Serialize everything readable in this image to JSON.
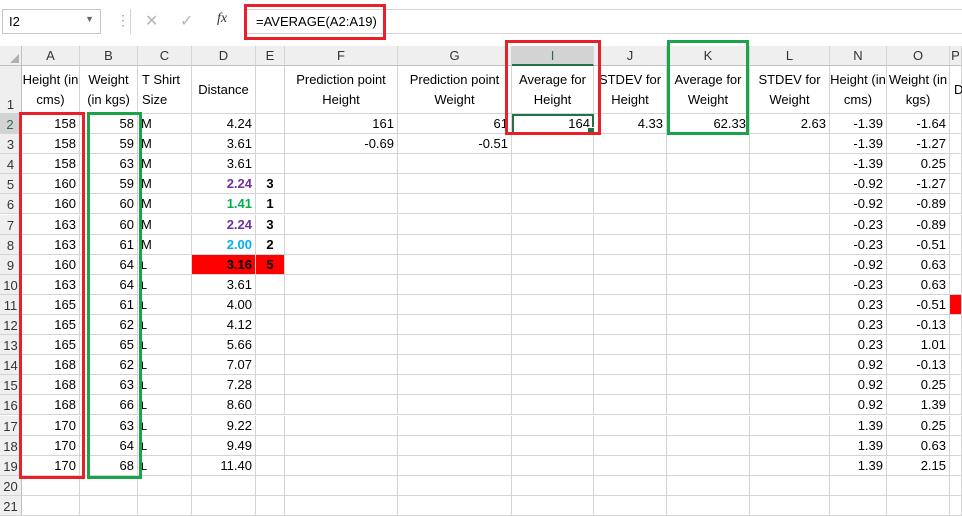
{
  "formula_bar": {
    "name_box": "I2",
    "cancel_icon": "✕",
    "enter_icon": "✓",
    "fx_label": "fx",
    "formula": "=AVERAGE(A2:A19)"
  },
  "colors": {
    "selection_green": "#217346",
    "annotation_red": "#e8202a",
    "annotation_green": "#1aa34a",
    "purple_value": "#7030a0",
    "green_value": "#00b050",
    "blue_value": "#00b0f0",
    "red_fill": "#ff0000"
  },
  "columns": [
    "A",
    "B",
    "C",
    "D",
    "E",
    "F",
    "G",
    "I",
    "J",
    "K",
    "L",
    "N",
    "O",
    "P"
  ],
  "rows": [
    "1",
    "2",
    "3",
    "4",
    "5",
    "6",
    "7",
    "8",
    "9",
    "10",
    "11",
    "12",
    "13",
    "14",
    "15",
    "16",
    "17",
    "18",
    "19",
    "20",
    "21"
  ],
  "headers": {
    "A": "Height (in cms)",
    "B": "Weight (in kgs)",
    "C": "T Shirt Size",
    "D": "Distance",
    "F": "Prediction point Height",
    "G": "Prediction point Weight",
    "I": "Average for Height",
    "J": "STDEV for Height",
    "K": "Average for Weight",
    "L": "STDEV for Weight",
    "N": "Height (in cms)",
    "O": "Weight (in kgs)",
    "P": "D"
  },
  "data": {
    "A": [
      "158",
      "158",
      "158",
      "160",
      "160",
      "163",
      "163",
      "160",
      "163",
      "165",
      "165",
      "165",
      "168",
      "168",
      "168",
      "170",
      "170",
      "170"
    ],
    "B": [
      "58",
      "59",
      "63",
      "59",
      "60",
      "60",
      "61",
      "64",
      "64",
      "61",
      "62",
      "65",
      "62",
      "63",
      "66",
      "63",
      "64",
      "68"
    ],
    "C": [
      "M",
      "M",
      "M",
      "M",
      "M",
      "M",
      "M",
      "L",
      "L",
      "L",
      "L",
      "L",
      "L",
      "L",
      "L",
      "L",
      "L",
      "L"
    ],
    "D": [
      "4.24",
      "3.61",
      "3.61",
      "2.24",
      "1.41",
      "2.24",
      "2.00",
      "3.16",
      "3.61",
      "4.00",
      "4.12",
      "5.66",
      "7.07",
      "7.28",
      "8.60",
      "9.22",
      "9.49",
      "11.40"
    ],
    "E": [
      "",
      "",
      "",
      "3",
      "1",
      "3",
      "2",
      "5",
      "",
      "",
      "",
      "",
      "",
      "",
      "",
      "",
      "",
      ""
    ],
    "N": [
      "-1.39",
      "-1.39",
      "-1.39",
      "-0.92",
      "-0.92",
      "-0.23",
      "-0.23",
      "-0.92",
      "-0.23",
      "0.23",
      "0.23",
      "0.23",
      "0.92",
      "0.92",
      "0.92",
      "1.39",
      "1.39",
      "1.39"
    ],
    "O": [
      "-1.64",
      "-1.27",
      "0.25",
      "-1.27",
      "-0.89",
      "-0.89",
      "-0.51",
      "0.63",
      "0.63",
      "-0.51",
      "-0.13",
      "1.01",
      "-0.13",
      "0.25",
      "1.39",
      "0.25",
      "0.63",
      "2.15"
    ]
  },
  "row2": {
    "F": "161",
    "G": "61",
    "I": "164",
    "J": "4.33",
    "K": "62.33",
    "L": "2.63"
  },
  "row3": {
    "F": "-0.69",
    "G": "-0.51"
  }
}
